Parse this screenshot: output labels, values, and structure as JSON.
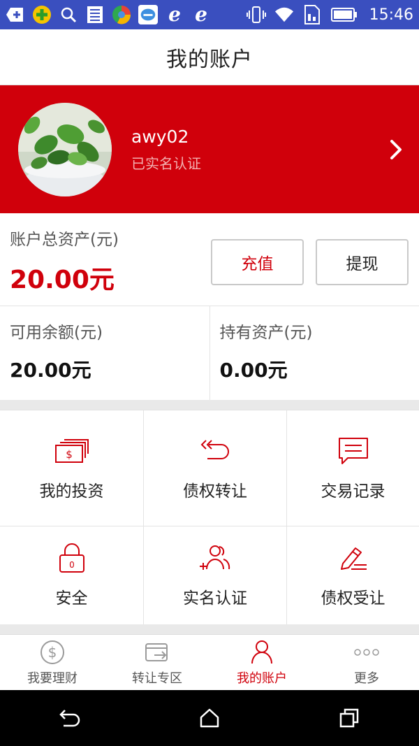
{
  "status_bar": {
    "time": "15:46",
    "icons": [
      "add-icon",
      "plus-app-icon",
      "search-icon",
      "news-icon",
      "browser-icon",
      "chat-icon",
      "ie-icon",
      "ie-icon",
      "vibrate-icon",
      "wifi-icon",
      "sim-icon",
      "battery-icon"
    ]
  },
  "header": {
    "title": "我的账户"
  },
  "profile": {
    "username": "awy02",
    "status": "已实名认证"
  },
  "assets": {
    "total_label": "账户总资产(元)",
    "total_value": "20.00元",
    "recharge_label": "充值",
    "withdraw_label": "提现"
  },
  "balances": [
    {
      "label": "可用余额(元)",
      "value": "20.00元"
    },
    {
      "label": "持有资产(元)",
      "value": "0.00元"
    }
  ],
  "menu": [
    {
      "label": "我的投资",
      "icon": "money-icon"
    },
    {
      "label": "债权转让",
      "icon": "transfer-icon"
    },
    {
      "label": "交易记录",
      "icon": "message-icon"
    },
    {
      "label": "安全",
      "icon": "lock-icon"
    },
    {
      "label": "实名认证",
      "icon": "add-user-icon"
    },
    {
      "label": "债权受让",
      "icon": "edit-icon"
    }
  ],
  "tabs": [
    {
      "label": "我要理财",
      "icon": "dollar-icon",
      "active": false
    },
    {
      "label": "转让专区",
      "icon": "exchange-icon",
      "active": false
    },
    {
      "label": "我的账户",
      "icon": "user-icon",
      "active": true
    },
    {
      "label": "更多",
      "icon": "more-icon",
      "active": false
    }
  ],
  "colors": {
    "accent": "#d0000b",
    "status_bar": "#3a4fbf"
  }
}
